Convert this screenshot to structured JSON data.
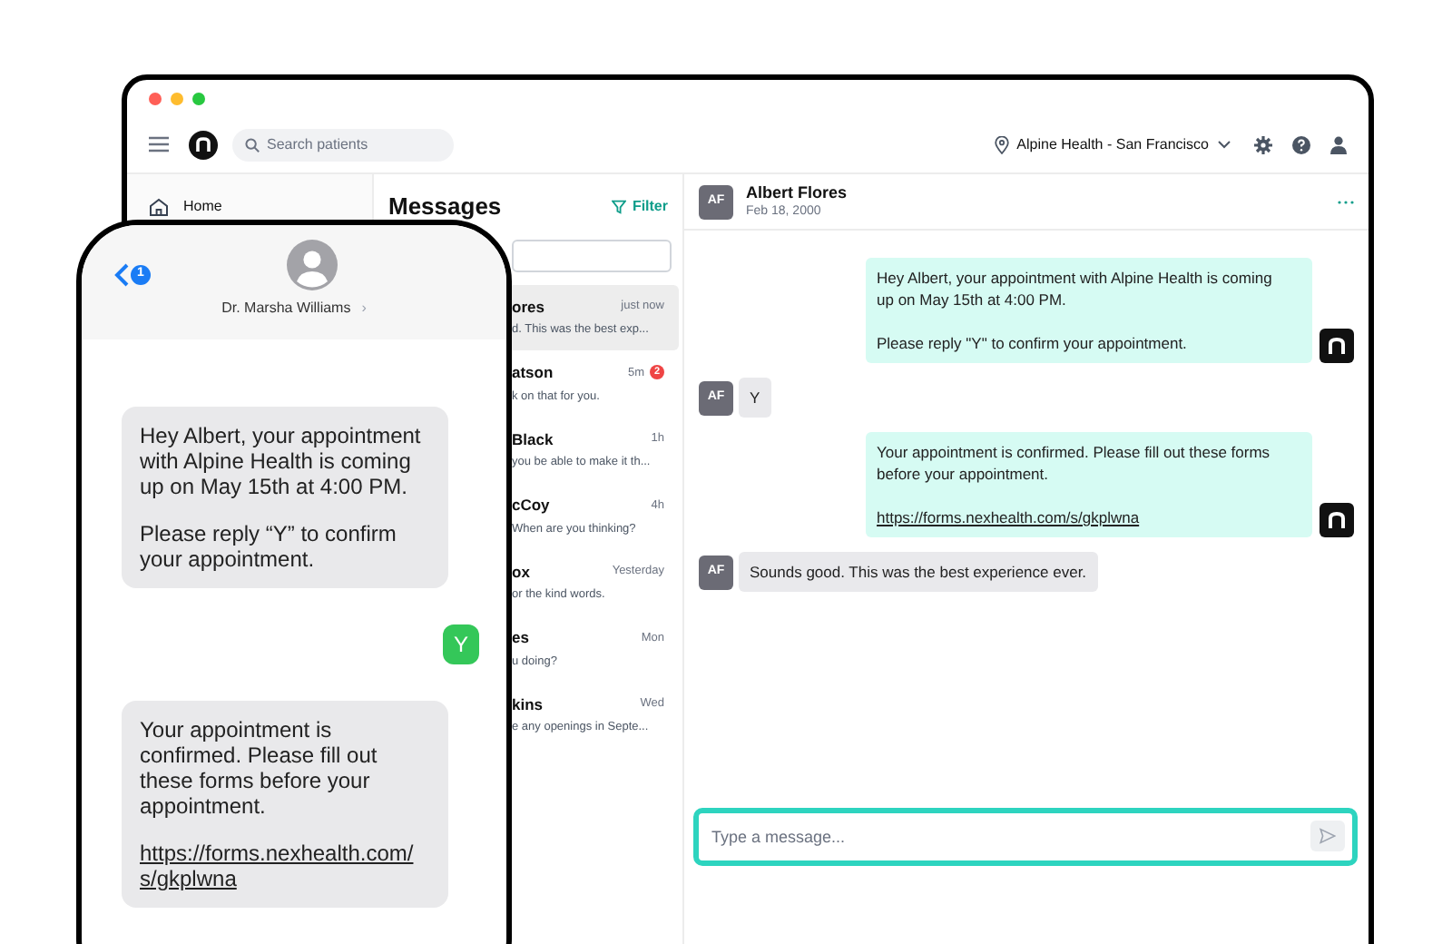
{
  "topbar": {
    "search_placeholder": "Search patients",
    "location": "Alpine Health - San Francisco"
  },
  "sidebar": {
    "items": [
      {
        "label": "Home"
      }
    ]
  },
  "messages": {
    "title": "Messages",
    "filter": "Filter",
    "conversations": [
      {
        "name": "ores",
        "preview": "d. This was the best exp...",
        "time": "just now",
        "selected": true
      },
      {
        "name": "atson",
        "preview": "k on that for you.",
        "time": "5m",
        "unread": "2",
        "selected": false
      },
      {
        "name": "Black",
        "preview": "you be able to make it th...",
        "time": "1h",
        "selected": false
      },
      {
        "name": "cCoy",
        "preview": "When are you thinking?",
        "time": "4h",
        "selected": false
      },
      {
        "name": "ox",
        "preview": "or the kind words.",
        "time": "Yesterday",
        "selected": false
      },
      {
        "name": "es",
        "preview": "u doing?",
        "time": "Mon",
        "selected": false
      },
      {
        "name": "kins",
        "preview": "e any openings in Septe...",
        "time": "Wed",
        "selected": false
      }
    ]
  },
  "chat": {
    "contact": {
      "initials": "AF",
      "name": "Albert Flores",
      "date": "Feb 18, 2000"
    },
    "messages": [
      {
        "kind": "outgoing",
        "paragraphs": [
          "Hey Albert, your appointment with Alpine Health is coming up on May 15th at 4:00 PM.",
          "Please reply \"Y\" to confirm your appointment."
        ]
      },
      {
        "kind": "incoming",
        "initials": "AF",
        "paragraphs": [
          "Y"
        ]
      },
      {
        "kind": "outgoing",
        "paragraphs": [
          "Your appointment is confirmed. Please fill out these forms before your appointment."
        ],
        "link": "https://forms.nexhealth.com/s/gkplwna"
      },
      {
        "kind": "incoming",
        "initials": "AF",
        "paragraphs": [
          "Sounds good. This was the best experience ever."
        ]
      }
    ],
    "composer": {
      "placeholder": "Type a message..."
    }
  },
  "phone": {
    "back_badge": "1",
    "contact": "Dr. Marsha Williams",
    "chevron": "›",
    "messages": [
      {
        "kind": "incoming",
        "paragraphs": [
          "Hey Albert, your appointment with Alpine Health is coming up on May 15th at 4:00 PM.",
          "Please reply “Y” to confirm your appointment."
        ]
      },
      {
        "kind": "outgoing",
        "paragraphs": [
          "Y"
        ]
      },
      {
        "kind": "incoming",
        "paragraphs": [
          "Your appointment is confirmed. Please fill out these forms before your appointment."
        ],
        "link": "https://forms.nexhealth.com/s/gkplwna"
      }
    ]
  }
}
